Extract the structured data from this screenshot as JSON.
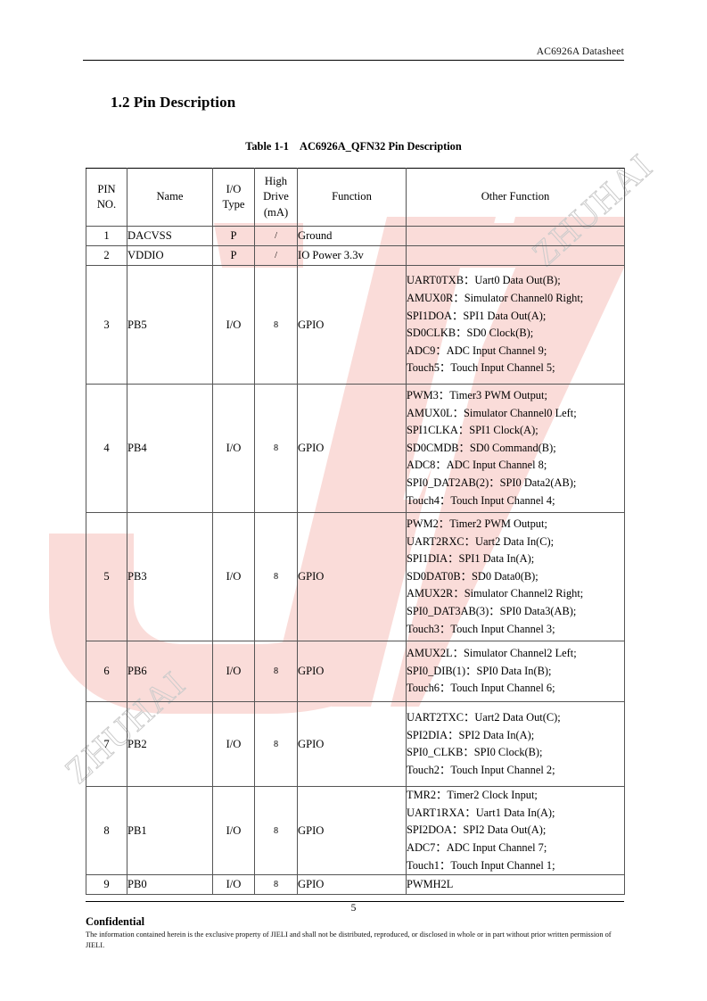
{
  "header": {
    "running_title": "AC6926A  Datasheet"
  },
  "section": {
    "number": "1.2",
    "title": "Pin Description",
    "heading": "1.2 Pin Description"
  },
  "table_caption": {
    "label": "Table 1-1",
    "title": "AC6926A_QFN32 Pin Description"
  },
  "table": {
    "columns": [
      {
        "key": "pin_no",
        "header_lines": [
          "PIN",
          "NO."
        ]
      },
      {
        "key": "name",
        "header_lines": [
          "Name"
        ]
      },
      {
        "key": "io_type",
        "header_lines": [
          "I/O",
          "Type"
        ]
      },
      {
        "key": "high_drive",
        "header_lines": [
          "High",
          "Drive",
          "(mA)"
        ]
      },
      {
        "key": "function",
        "header_lines": [
          "Function"
        ]
      },
      {
        "key": "other_function",
        "header_lines": [
          "Other Function"
        ]
      }
    ],
    "rows": [
      {
        "pin_no": "1",
        "name": "DACVSS",
        "io_type": "P",
        "high_drive": "/",
        "function": "Ground",
        "other_function": []
      },
      {
        "pin_no": "2",
        "name": "VDDIO",
        "io_type": "P",
        "high_drive": "/",
        "function": "IO Power 3.3v",
        "other_function": []
      },
      {
        "pin_no": "3",
        "name": "PB5",
        "io_type": "I/O",
        "high_drive": "8",
        "function": "GPIO",
        "other_function": [
          "UART0TXB：Uart0 Data Out(B);",
          "AMUX0R：Simulator Channel0 Right;",
          "SPI1DOA：SPI1 Data Out(A);",
          "SD0CLKB：SD0 Clock(B);",
          "ADC9：ADC Input Channel 9;",
          "Touch5：Touch Input Channel 5;"
        ]
      },
      {
        "pin_no": "4",
        "name": "PB4",
        "io_type": "I/O",
        "high_drive": "8",
        "function": "GPIO",
        "other_function": [
          "PWM3：Timer3 PWM Output;",
          "AMUX0L：Simulator Channel0 Left;",
          "SPI1CLKA：SPI1 Clock(A);",
          "SD0CMDB：SD0 Command(B);",
          "ADC8：ADC Input Channel 8;",
          "SPI0_DAT2AB(2)：SPI0 Data2(AB);",
          "Touch4：Touch Input Channel 4;"
        ]
      },
      {
        "pin_no": "5",
        "name": "PB3",
        "io_type": "I/O",
        "high_drive": "8",
        "function": "GPIO",
        "other_function": [
          "PWM2：Timer2 PWM Output;",
          "UART2RXC：Uart2 Data In(C);",
          "SPI1DIA：SPI1 Data In(A);",
          "SD0DAT0B：SD0 Data0(B);",
          "AMUX2R：Simulator Channel2 Right;",
          "SPI0_DAT3AB(3)：SPI0 Data3(AB);",
          "Touch3：Touch Input Channel 3;"
        ]
      },
      {
        "pin_no": "6",
        "name": "PB6",
        "io_type": "I/O",
        "high_drive": "8",
        "function": "GPIO",
        "other_function": [
          "AMUX2L：Simulator Channel2 Left;",
          "SPI0_DIB(1)：SPI0 Data In(B);",
          "Touch6：Touch Input Channel 6;"
        ]
      },
      {
        "pin_no": "7",
        "name": "PB2",
        "io_type": "I/O",
        "high_drive": "8",
        "function": "GPIO",
        "other_function": [
          "UART2TXC：Uart2 Data Out(C);",
          "SPI2DIA：SPI2 Data In(A);",
          "SPI0_CLKB：SPI0 Clock(B);",
          "Touch2：Touch Input Channel 2;"
        ]
      },
      {
        "pin_no": "8",
        "name": "PB1",
        "io_type": "I/O",
        "high_drive": "8",
        "function": "GPIO",
        "other_function": [
          "TMR2：Timer2 Clock Input;",
          "UART1RXA：Uart1 Data In(A);",
          "SPI2DOA：SPI2 Data Out(A);",
          "ADC7：ADC Input Channel 7;",
          "Touch1：Touch Input Channel 1;"
        ]
      },
      {
        "pin_no": "9",
        "name": "PB0",
        "io_type": "I/O",
        "high_drive": "8",
        "function": "GPIO",
        "other_function": [
          "PWMH2L"
        ]
      }
    ]
  },
  "footer": {
    "page_number": "5",
    "confidential": "Confidential",
    "disclaimer": "The information contained herein is the exclusive property of JIELI and shall not be distributed, reproduced, or disclosed in whole or in part without prior written permission of JIELI."
  },
  "watermarks": {
    "logo_text": "JL",
    "logo_color": "#fadcd9",
    "diagonal_text": "ZHUHAI",
    "diagonal_color": "#c9c9c9"
  },
  "colors": {
    "highlight_pink": "#fadcd9",
    "table_border": "#555555",
    "outer_border": "#000000",
    "text": "#000000"
  }
}
